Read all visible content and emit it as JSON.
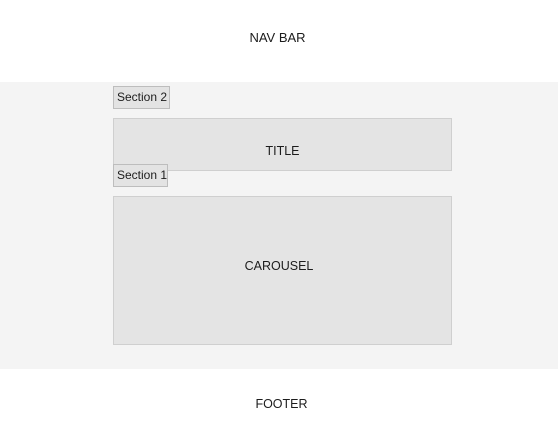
{
  "nav_bar": {
    "label": "NAV BAR"
  },
  "sections": {
    "section_2": {
      "label": "Section 2"
    },
    "section_1": {
      "label": "Section 1"
    }
  },
  "title_block": {
    "label": "TITLE"
  },
  "carousel_block": {
    "label": "CAROUSEL"
  },
  "footer": {
    "label": "FOOTER"
  },
  "colors": {
    "background": "#ffffff",
    "main_band": "#f4f4f4",
    "block_fill": "#e4e4e4",
    "tag_fill": "#e3e3e3",
    "text": "#1c1c1c"
  }
}
